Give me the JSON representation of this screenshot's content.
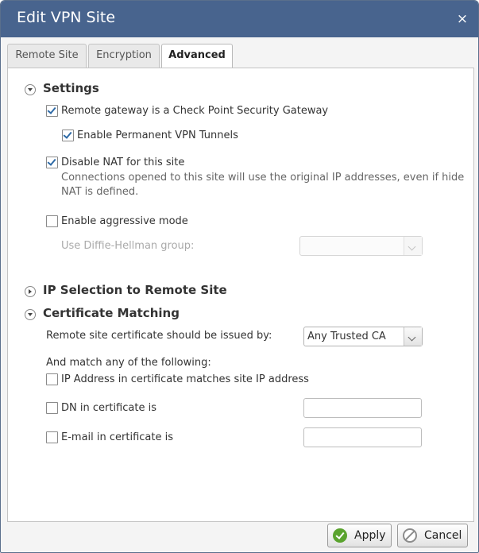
{
  "window": {
    "title": "Edit VPN Site",
    "close_label": "×"
  },
  "tabs": [
    {
      "label": "Remote Site",
      "active": false
    },
    {
      "label": "Encryption",
      "active": false
    },
    {
      "label": "Advanced",
      "active": true
    }
  ],
  "settings": {
    "header": "Settings",
    "expanded": true,
    "remote_gateway_label": "Remote gateway is a Check Point Security Gateway",
    "remote_gateway_checked": true,
    "permanent_tunnels_label": "Enable Permanent VPN Tunnels",
    "permanent_tunnels_checked": true,
    "disable_nat_label": "Disable NAT for this site",
    "disable_nat_checked": true,
    "disable_nat_desc_line1": "Connections opened to this site will use the original IP addresses, even if hide",
    "disable_nat_desc_line2": "NAT is defined.",
    "aggressive_mode_label": "Enable aggressive mode",
    "aggressive_mode_checked": false,
    "dh_group_label": "Use Diffie-Hellman group:",
    "dh_group_value": ""
  },
  "ip_selection": {
    "header": "IP Selection to Remote Site",
    "expanded": false
  },
  "certificate_matching": {
    "header": "Certificate Matching",
    "expanded": true,
    "issued_by_label": "Remote site certificate should be issued by:",
    "issued_by_value": "Any Trusted CA",
    "match_any_label": "And match any of the following:",
    "ip_match_label": "IP Address in certificate matches site IP address",
    "ip_match_checked": false,
    "dn_label": "DN in certificate is",
    "dn_checked": false,
    "dn_value": "",
    "email_label": "E-mail in certificate is",
    "email_checked": false,
    "email_value": ""
  },
  "footer": {
    "apply_label": "Apply",
    "cancel_label": "Cancel"
  },
  "colors": {
    "titlebar": "#48648e",
    "checkmark": "#2e6aa6",
    "apply_icon": "#5aa32e"
  },
  "icons": {
    "close": "close-icon",
    "expand_down": "chevron-down-icon",
    "expand_right": "chevron-right-icon",
    "apply": "check-circle-icon",
    "cancel": "no-entry-icon"
  }
}
